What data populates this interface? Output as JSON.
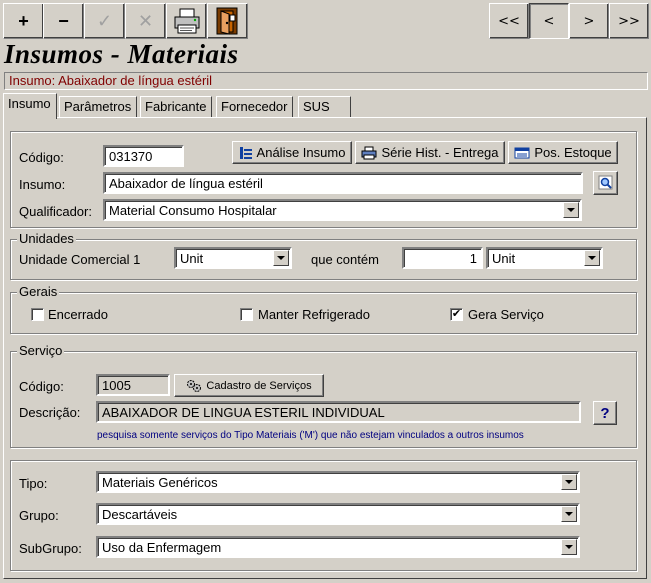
{
  "toolbar": {
    "add_label": "+",
    "remove_label": "−",
    "confirm_label": "✓",
    "cancel_label": "✕",
    "print_icon": "printer-icon",
    "exit_icon": "exit-door-icon"
  },
  "navigator": {
    "first": "<<",
    "prior": "<",
    "next": ">",
    "last": ">>"
  },
  "window": {
    "title": "Insumos - Materiais",
    "status_text": "Insumo:  Abaixador de língua estéril"
  },
  "tabs": [
    "Insumo",
    "Parâmetros",
    "Fabricante",
    "Fornecedor",
    "SUS"
  ],
  "insumo": {
    "codigo_label": "Código:",
    "codigo_value": "031370",
    "insumo_label": "Insumo:",
    "insumo_value": "Abaixador de língua estéril",
    "qualificador_label": "Qualificador:",
    "qualificador_value": "Material Consumo Hospitalar",
    "btn_analise": "Análise Insumo",
    "btn_serie": "Série Hist. - Entrega",
    "btn_estoque": "Pos. Estoque"
  },
  "unidades": {
    "legend": "Unidades",
    "unidade_label": "Unidade Comercial 1",
    "unidade_value": "Unit",
    "contem_label": "que contém",
    "contem_qty": "1",
    "contem_unit": "Unit"
  },
  "gerais": {
    "legend": "Gerais",
    "encerrado_label": "Encerrado",
    "encerrado_checked": false,
    "refrigerado_label": "Manter Refrigerado",
    "refrigerado_checked": false,
    "gera_servico_label": "Gera Serviço",
    "gera_servico_checked": true,
    "check_mark": "✔"
  },
  "servico": {
    "legend": "Serviço",
    "codigo_label": "Código:",
    "codigo_value": "1005",
    "btn_cadastro": "Cadastro de Serviços",
    "descricao_label": "Descrição:",
    "descricao_value": "ABAIXADOR DE LINGUA  ESTERIL INDIVIDUAL",
    "help_label": "?",
    "hint": "pesquisa somente serviços do Tipo Materiais ('M') que não estejam vinculados a outros insumos"
  },
  "classificacao": {
    "tipo_label": "Tipo:",
    "tipo_value": "Materiais Genéricos",
    "grupo_label": "Grupo:",
    "grupo_value": "Descartáveis",
    "subgrupo_label": "SubGrupo:",
    "subgrupo_value": "Uso da Enfermagem"
  }
}
